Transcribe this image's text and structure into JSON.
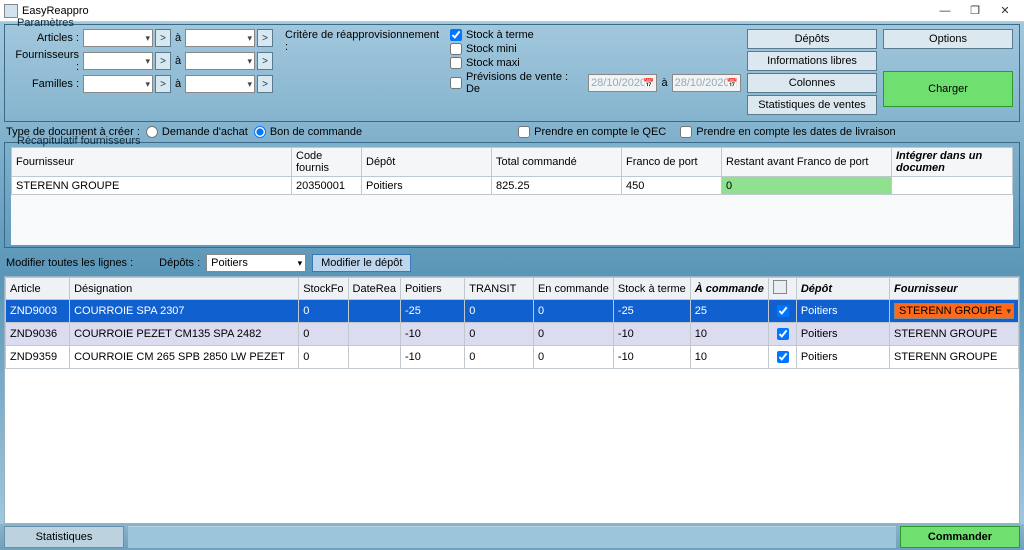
{
  "window": {
    "title": "EasyReappro"
  },
  "params": {
    "group_label": "Paramètres",
    "labels": {
      "articles": "Articles :",
      "fournisseurs": "Fournisseurs :",
      "familles": "Familles :",
      "a": "à"
    },
    "criteria_label": "Critère de réapprovisionnement :",
    "stock_a_terme": "Stock à terme",
    "stock_mini": "Stock mini",
    "stock_maxi": "Stock maxi",
    "previsions": "Prévisions de vente :  De",
    "date_from": "28/10/2020",
    "date_to": "28/10/2020",
    "date_a": "à",
    "side_buttons": {
      "depots": "Dépôts",
      "infos": "Informations libres",
      "colonnes": "Colonnes",
      "stats_ventes": "Statistiques de ventes"
    },
    "options": "Options",
    "charger": "Charger",
    "doctype_label": "Type de document à créer :",
    "demande_achat": "Demande d'achat",
    "bon_commande": "Bon de commande",
    "qec": "Prendre en compte le QEC",
    "dates_livraison": "Prendre en compte les dates de livraison"
  },
  "recap": {
    "group_label": "Récapitulatif fournisseurs",
    "headers": {
      "fournisseur": "Fournisseur",
      "code": "Code fournis",
      "depot": "Dépôt",
      "total": "Total commandé",
      "franco": "Franco de port",
      "restant": "Restant avant Franco de port",
      "integrer": "Intégrer dans un documen"
    },
    "row": {
      "fournisseur": "STERENN GROUPE",
      "code": "20350001",
      "depot": "Poitiers",
      "total": "825.25",
      "franco": "450",
      "restant": "0"
    }
  },
  "modline": {
    "label": "Modifier toutes les lignes :",
    "depots_label": "Dépôts :",
    "depot_value": "Poitiers",
    "modifier_btn": "Modifier le dépôt"
  },
  "grid": {
    "headers": {
      "article": "Article",
      "designation": "Désignation",
      "stockfo": "StockFo",
      "daterea": "DateRea",
      "poitiers": "Poitiers",
      "transit": "TRANSIT",
      "encommande": "En commande",
      "stockaterme": "Stock à terme",
      "acommander": "À commande",
      "depot": "Dépôt",
      "fournisseur": "Fournisseur"
    },
    "rows": [
      {
        "article": "ZND9003",
        "designation": "COURROIE         SPA 2307",
        "stockfo": "0",
        "daterea": "",
        "poitiers": "-25",
        "transit": "0",
        "encommande": "0",
        "stockaterme": "-25",
        "acommander": "25",
        "chk": true,
        "depot": "Poitiers",
        "fournisseur": "STERENN GROUPE"
      },
      {
        "article": "ZND9036",
        "designation": "COURROIE PEZET CM135      SPA 2482",
        "stockfo": "0",
        "daterea": "",
        "poitiers": "-10",
        "transit": "0",
        "encommande": "0",
        "stockaterme": "-10",
        "acommander": "10",
        "chk": true,
        "depot": "Poitiers",
        "fournisseur": "STERENN GROUPE"
      },
      {
        "article": "ZND9359",
        "designation": "COURROIE    CM 265      SPB 2850 LW  PEZET",
        "stockfo": "0",
        "daterea": "",
        "poitiers": "-10",
        "transit": "0",
        "encommande": "0",
        "stockaterme": "-10",
        "acommander": "10",
        "chk": true,
        "depot": "Poitiers",
        "fournisseur": "STERENN GROUPE"
      }
    ]
  },
  "footer": {
    "stats": "Statistiques",
    "commander": "Commander"
  }
}
